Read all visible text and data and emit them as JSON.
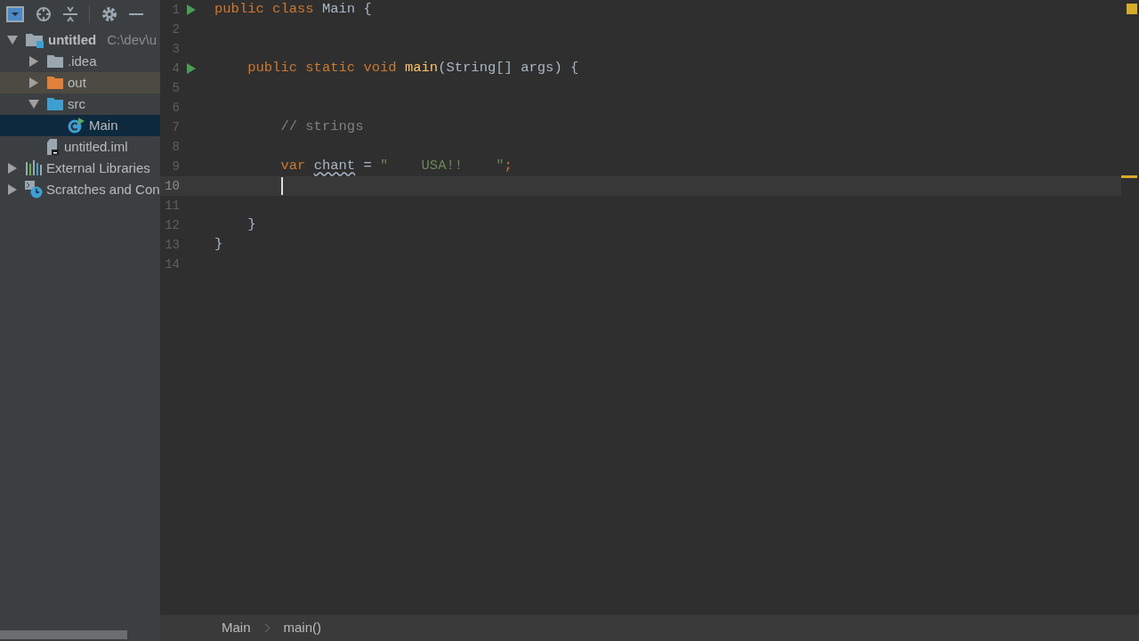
{
  "project_tree": [
    {
      "label": "untitled",
      "kind": "project",
      "path": "C:\\dev\\u",
      "expanded": true,
      "selected": false,
      "highlighted": false,
      "children": [
        {
          "label": ".idea",
          "kind": "folder",
          "color": "#9aa7b0",
          "expanded": false,
          "selected": false,
          "highlighted": false
        },
        {
          "label": "out",
          "kind": "folder",
          "color": "#e0803a",
          "expanded": false,
          "selected": false,
          "highlighted": true
        },
        {
          "label": "src",
          "kind": "folder",
          "color": "#3d9fd2",
          "expanded": true,
          "selected": false,
          "highlighted": false,
          "children": [
            {
              "label": "Main",
              "kind": "class",
              "selected": true,
              "highlighted": false
            }
          ]
        },
        {
          "label": "untitled.iml",
          "kind": "file",
          "selected": false,
          "highlighted": false
        }
      ]
    },
    {
      "label": "External Libraries",
      "kind": "libraries",
      "expanded": false,
      "selected": false,
      "highlighted": false
    },
    {
      "label": "Scratches and Con",
      "kind": "scratches",
      "expanded": false,
      "selected": false,
      "highlighted": false
    }
  ],
  "editor": {
    "lines": [
      {
        "number": "1",
        "runnable": true,
        "current": false,
        "tokens": [
          {
            "text": "public class ",
            "kind": "keyword"
          },
          {
            "text": "Main {",
            "kind": "plain"
          }
        ]
      },
      {
        "number": "2",
        "runnable": false,
        "current": false
      },
      {
        "number": "3",
        "runnable": false,
        "current": false
      },
      {
        "number": "4",
        "runnable": true,
        "current": false,
        "tokens": [
          {
            "text": "    public static void ",
            "kind": "keyword"
          },
          {
            "text": "main",
            "kind": "method"
          },
          {
            "text": "(String[] args) {",
            "kind": "plain"
          }
        ]
      },
      {
        "number": "5",
        "runnable": false,
        "current": false
      },
      {
        "number": "6",
        "runnable": false,
        "current": false
      },
      {
        "number": "7",
        "runnable": false,
        "current": false,
        "tokens": [
          {
            "text": "        // strings",
            "kind": "comment"
          }
        ]
      },
      {
        "number": "8",
        "runnable": false,
        "current": false
      },
      {
        "number": "9",
        "runnable": false,
        "current": false,
        "tokens": [
          {
            "text": "        var ",
            "kind": "keyword"
          },
          {
            "text": "chant",
            "kind": "warning"
          },
          {
            "text": " = ",
            "kind": "plain"
          },
          {
            "text": "\"    USA!!    \"",
            "kind": "string"
          },
          {
            "text": ";",
            "kind": "keyword"
          }
        ]
      },
      {
        "number": "10",
        "runnable": false,
        "current": true
      },
      {
        "number": "11",
        "runnable": false,
        "current": false
      },
      {
        "number": "12",
        "runnable": false,
        "current": false,
        "tokens": [
          {
            "text": "    }",
            "kind": "plain"
          }
        ]
      },
      {
        "number": "13",
        "runnable": false,
        "current": false,
        "tokens": [
          {
            "text": "}",
            "kind": "plain"
          }
        ]
      },
      {
        "number": "14",
        "runnable": false,
        "current": false
      }
    ]
  },
  "breadcrumbs": [
    "Main",
    "main()"
  ]
}
